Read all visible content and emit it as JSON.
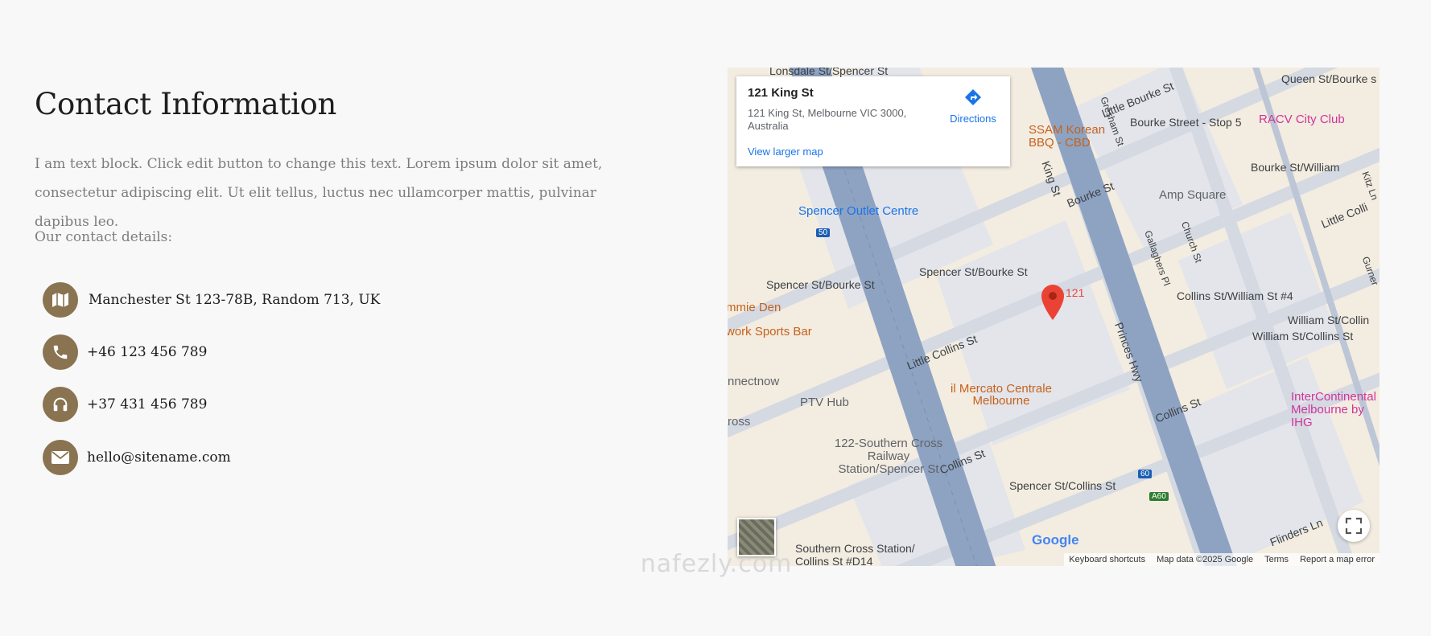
{
  "contact": {
    "title": "Contact Information",
    "description": "I am text block. Click edit button to change this text. Lorem ipsum dolor sit amet, consectetur adipiscing elit. Ut elit tellus, luctus nec ullamcorper mattis, pulvinar dapibus leo.",
    "details_label": "Our contact details:",
    "items": [
      {
        "icon": "map-icon",
        "text": "Manchester St 123-78B, Random 713, UK"
      },
      {
        "icon": "phone-icon",
        "text": "+46 123 456 789"
      },
      {
        "icon": "headphones-icon",
        "text": "+37 431 456 789"
      },
      {
        "icon": "envelope-icon",
        "text": "hello@sitename.com"
      }
    ],
    "icon_background": "#8a7350"
  },
  "map": {
    "place_name": "121 King St",
    "place_address": "121 King St, Melbourne VIC 3000, Australia",
    "directions_label": "Directions",
    "larger_map_label": "View larger map",
    "marker_label": "121",
    "google_logo": "Google",
    "labels": {
      "lonsdale": "Lonsdale St/Spencer St",
      "little_bourke": "Little Bourke St",
      "queen": "Queen St/Bourke s",
      "bourke_stop": "Bourke Street - Stop 5",
      "racv": "RACV City Club",
      "ssam": "SSAM Korean BBQ - CBD",
      "bourke_william": "Bourke St/William",
      "king_st": "King St",
      "bourke_st": "Bourke St",
      "amp": "Amp Square",
      "spencer_outlet": "Spencer Outlet Centre",
      "little_collins_right": "Little Colli",
      "spencer_bourke_1": "Spencer St/Bourke St",
      "spencer_bourke_2": "Spencer St/Bourke St",
      "mmie_den": "mmie Den",
      "collins_william_4": "Collins St/William St #4",
      "william_collins_1": "William St/Collin",
      "william_collins_2": "William St/Collins St",
      "sports_bar": "work Sports Bar",
      "princes_hwy": "Princes Hwy",
      "little_collins": "Little Collins St",
      "nnectnow": "nnectnow",
      "il_mercato": "il Mercato Centrale Melbourne",
      "ptv_hub": "PTV Hub",
      "intercontinental": "InterContinental Melbourne by IHG",
      "ross": "ross",
      "collins_st": "Collins St",
      "railway": "122-Southern Cross Railway Station/Spencer St",
      "collins_st_2": "Collins St",
      "spencer_collins": "Spencer St/Collins St",
      "flinders": "Flinders Ln",
      "southern_cross": "Southern Cross Station/ Collins St #D14",
      "gresham": "Gresham St",
      "church": "Church St",
      "gallaghers": "Gallaghers Pl",
      "kitz": "Kitz Ln",
      "gurner": "Gurner",
      "a60": "A60",
      "r60": "60",
      "r50": "50"
    },
    "footer": {
      "keyboard": "Keyboard shortcuts",
      "map_data": "Map data ©2025 Google",
      "terms": "Terms",
      "report": "Report a map error"
    }
  },
  "watermark": "nafezly.com"
}
